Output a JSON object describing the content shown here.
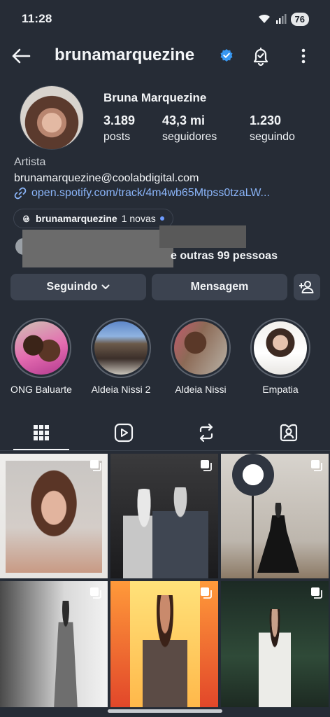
{
  "status_bar": {
    "time": "11:28",
    "battery": "76"
  },
  "header": {
    "username": "brunamarquezine"
  },
  "profile": {
    "display_name": "Bruna Marquezine",
    "stats": [
      {
        "value": "3.189",
        "label": "posts"
      },
      {
        "value": "43,3 mi",
        "label": "seguidores"
      },
      {
        "value": "1.230",
        "label": "seguindo"
      }
    ],
    "category": "Artista",
    "email": "brunamarquezine@coolabdigital.com",
    "link": "open.spotify.com/track/4m4wb65Mtpss0tzaLW..."
  },
  "threads": {
    "handle": "brunamarquezine",
    "new_count": "1 novas"
  },
  "followed_by": {
    "text": "e outras 99 pessoas"
  },
  "actions": {
    "following_label": "Seguindo",
    "message_label": "Mensagem"
  },
  "highlights": [
    {
      "label": "ONG Baluarte"
    },
    {
      "label": "Aldeia Nissi 2"
    },
    {
      "label": "Aldeia Nissi"
    },
    {
      "label": "Empatia"
    }
  ],
  "tabs": [
    {
      "icon": "grid-icon"
    },
    {
      "icon": "reels-icon"
    },
    {
      "icon": "reposts-icon"
    },
    {
      "icon": "tagged-icon"
    }
  ],
  "colors": {
    "background": "#262c36",
    "link": "#8ab4f8",
    "verified": "#3897f0",
    "button": "#3c4350"
  }
}
